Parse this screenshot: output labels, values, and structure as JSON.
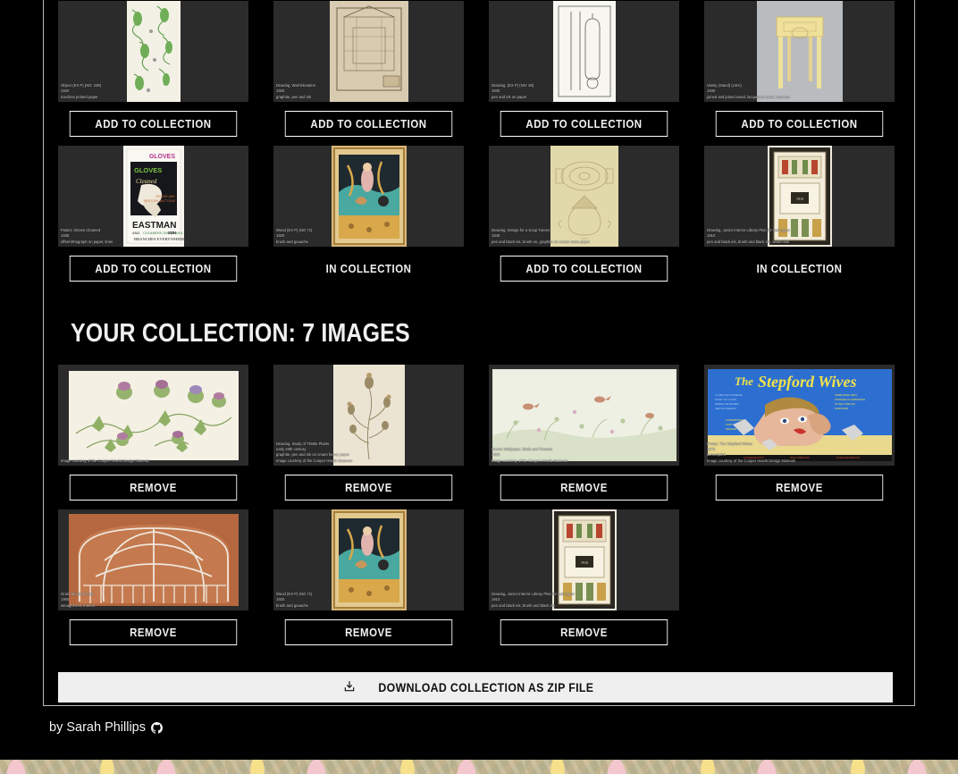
{
  "author": {
    "prefix": "by Sarah Phillips",
    "icon": "github-icon"
  },
  "labels": {
    "add_to_collection": "Add to Collection",
    "in_collection": "In Collection",
    "remove": "Remove",
    "download": "Download Collection as ZIP File",
    "download_icon": "download-icon"
  },
  "collection_heading": "Your Collection: 7 Images",
  "results": [
    {
      "caption": "Object (EX P) (NO: 238)\n1920\nmachine printed paper",
      "state": "add",
      "action": "Add to Collection",
      "art": "green-floral-wallpaper"
    },
    {
      "caption": "Drawing, Wall Elevation\n1920\ngraphite, pen and ink",
      "state": "add",
      "action": "Add to Collection",
      "art": "architectural-elevation"
    },
    {
      "caption": "Drawing, (EX P) (NO: 38)\n1930\npen and ink on paper",
      "state": "add",
      "action": "Add to Collection",
      "art": "lamp-technical-drawing"
    },
    {
      "caption": "Vanity (Stand) (USA)\n1930\njoined and joined wood, lacquered wood, laminate",
      "state": "add",
      "action": "Add to Collection",
      "art": "yellow-vanity-table"
    },
    {
      "caption": "Poster, Gloves Cleaned\n1935\noffset lithograph on paper, linen",
      "state": "add",
      "action": "Add to Collection",
      "art": "gloves-eastman-poster"
    },
    {
      "caption": "Wood (EX P) (NO 71)\n1920\nbrush and gouache",
      "state": "in",
      "action": "In Collection",
      "art": "persian-miniature"
    },
    {
      "caption": "Drawing, Design for a Soup Tureen\n1940\npen and black ink, brush on, graphite on cream wove paper",
      "state": "add",
      "action": "Add to Collection",
      "art": "tureen-design-sepia"
    },
    {
      "caption": "Drawing, Junior Interior Library Plan for wall paper\n1910\npen and black ink, brush and black ink, watercolor",
      "state": "in",
      "action": "In Collection",
      "art": "ornamental-panel"
    }
  ],
  "collection": [
    {
      "caption": "Image courtesy of the Cooper Hewitt Design Museum",
      "action": "Remove",
      "art": "thistle-botanical-drawing"
    },
    {
      "caption": "Drawing, Study of Thistle Plants\nearly 20th century\ngraphite, pen and ink on cream heavy paper\nImage courtesy of the Cooper Hewitt Museum",
      "action": "Remove",
      "art": "thistle-study-sepia"
    },
    {
      "caption": "Scenic Wallpaper, Birds and Flowers\n1920\nImage courtesy of the Cooper Hewitt Museum",
      "action": "Remove",
      "art": "scenic-birds-wallpaper"
    },
    {
      "caption": "Poster, The Stepford Wives\n1975\nscreenprint\nImage courtesy of the Cooper Hewitt Design Museum",
      "action": "Remove",
      "art": "stepford-wives-poster"
    },
    {
      "caption": "Grain Blocking Gate\n1900\nwrought iron, interior",
      "action": "Remove",
      "art": "wrought-iron-gate"
    },
    {
      "caption": "Wood (EX P) (NO 71)\n1920\nbrush and gouache",
      "action": "Remove",
      "art": "persian-miniature"
    },
    {
      "caption": "Drawing, Junior Interior Library Plan for wall paper\n1910\npen and black ink, brush and black ink",
      "action": "Remove",
      "art": "ornamental-panel"
    }
  ],
  "colors": {
    "panel_bg": "#000000",
    "thumb_bg": "#2b2b2b",
    "button_border": "#ffffff",
    "download_bg": "#efefef",
    "wallpaper_base": "#beb094"
  }
}
